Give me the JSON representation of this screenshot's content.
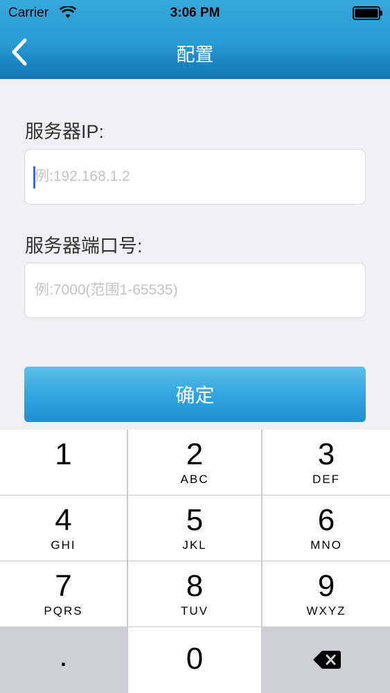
{
  "status_bar": {
    "carrier": "Carrier",
    "time": "3:06 PM"
  },
  "nav": {
    "title": "配置",
    "back_icon": "chevron-left-icon"
  },
  "form": {
    "server_ip_label": "服务器IP:",
    "server_ip_placeholder": "例:192.168.1.2",
    "server_ip_value": "",
    "server_port_label": "服务器端口号:",
    "server_port_placeholder": "例:7000(范围1-65535)",
    "server_port_value": "",
    "confirm_label": "确定"
  },
  "keypad": {
    "keys": [
      {
        "digit": "1",
        "letters": ""
      },
      {
        "digit": "2",
        "letters": "ABC"
      },
      {
        "digit": "3",
        "letters": "DEF"
      },
      {
        "digit": "4",
        "letters": "GHI"
      },
      {
        "digit": "5",
        "letters": "JKL"
      },
      {
        "digit": "6",
        "letters": "MNO"
      },
      {
        "digit": "7",
        "letters": "PQRS"
      },
      {
        "digit": "8",
        "letters": "TUV"
      },
      {
        "digit": "9",
        "letters": "WXYZ"
      }
    ],
    "dot": ".",
    "zero": "0",
    "delete_icon": "backspace-icon"
  },
  "colors": {
    "header_blue": "#2a9ad3",
    "button_blue": "#36a7df",
    "caret": "#3a6ad8"
  }
}
